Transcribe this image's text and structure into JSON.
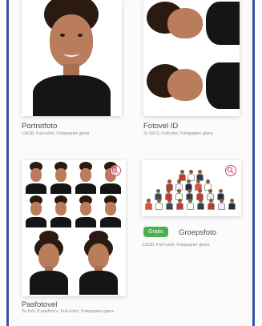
{
  "products": [
    {
      "title": "Portretfoto",
      "subtitle": "13x18, Full-color, Fotopapier glans"
    },
    {
      "title": "Fotovel ID",
      "subtitle": "2x 9x13, Fullcolor, Fotopapier glans"
    },
    {
      "title": "Pasfotovel",
      "subtitle": "2x 6x9, 8 pasfoto's, Full-color, Fotopapier glans"
    },
    {
      "title": "Groepsfoto",
      "badge": "Gratis",
      "subtitle": "13x20, Full-color, Fotopapier glans"
    }
  ],
  "icons": {
    "zoom": "zoom-in-icon"
  },
  "colors": {
    "frame": "#3a4fa8",
    "badge": "#4cae4f",
    "zoom": "#d63c60",
    "text": "#4b4b4b"
  }
}
